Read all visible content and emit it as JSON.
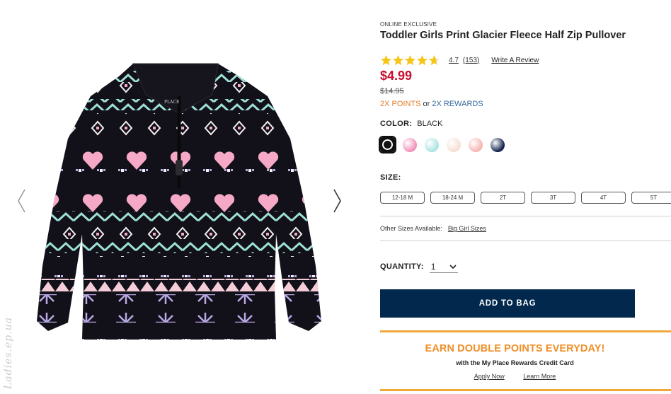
{
  "gallery": {
    "prev_icon": "chevron-left-icon",
    "next_icon": "chevron-right-icon",
    "image_alt": "Toddler Girls Print Glacier Fleece Half Zip Pullover",
    "watermark": "Ladies.ep.ua"
  },
  "product": {
    "eyebrow": "ONLINE EXCLUSIVE",
    "title": "Toddler Girls Print Glacier Fleece Half Zip Pullover",
    "rating": {
      "stars": 4.7,
      "value_label": "4.7",
      "count_label": "(153)",
      "write_review": "Write A Review",
      "star_color": "#f5c518"
    },
    "price": "$4.99",
    "original_price": "$14.95",
    "points": {
      "points_label": "2X POINTS",
      "connector": "or",
      "rewards_label": "2X REWARDS"
    },
    "color": {
      "label": "COLOR:",
      "selected": "BLACK",
      "swatches": [
        "#111111",
        "#f28fb7",
        "#a9e3e2",
        "#f6ded3",
        "#f4b4b0",
        "#0b1b48"
      ]
    },
    "size": {
      "label": "SIZE:",
      "options": [
        "12-18 M",
        "18-24 M",
        "2T",
        "3T",
        "4T",
        "5T"
      ]
    },
    "other_sizes": {
      "label": "Other Sizes Available:",
      "link": "Big Girl Sizes"
    },
    "quantity": {
      "label": "QUANTITY:",
      "value": "1"
    },
    "add_to_bag": "ADD TO BAG"
  },
  "promo": {
    "title": "EARN DOUBLE POINTS EVERYDAY!",
    "subtitle": "with the My Place Rewards Credit Card",
    "apply": "Apply Now",
    "learn": "Learn More",
    "accent": "#ef8f28"
  },
  "colors": {
    "price_red": "#c8102e",
    "navy": "#03284e",
    "points_orange": "#e37d2c",
    "rewards_blue": "#35699e"
  }
}
